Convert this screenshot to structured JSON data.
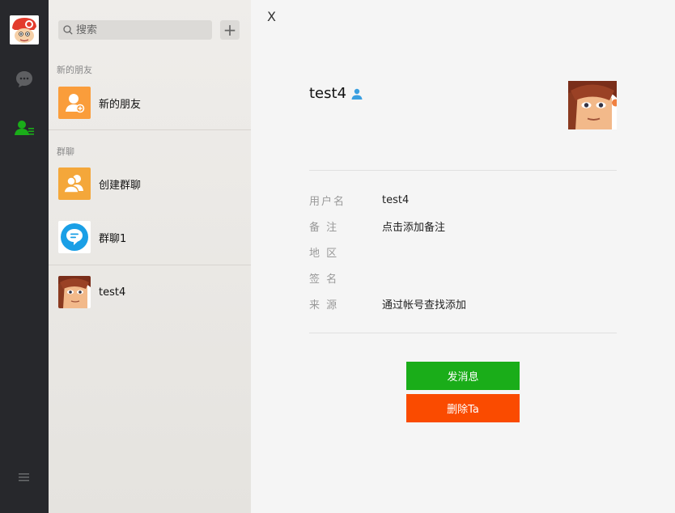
{
  "search": {
    "placeholder": "搜索"
  },
  "add_label": "+",
  "sections": {
    "new_friends": "新的朋友",
    "groups": "群聊"
  },
  "contacts": {
    "new_friends": {
      "name": "新的朋友",
      "icon": "add-friend-icon",
      "color": "#fa9d3b"
    },
    "create_group": {
      "name": "创建群聊",
      "icon": "group-icon",
      "color": "#f4a73a"
    },
    "group1": {
      "name": "群聊1",
      "icon": "chat-bubble-icon",
      "color": "#1a9fe6"
    },
    "test4": {
      "name": "test4",
      "icon": "avatar"
    }
  },
  "detail": {
    "close_label": "X",
    "nickname": "test4",
    "gender_icon": "person-icon",
    "fields": [
      {
        "key": "用户名",
        "value": "test4"
      },
      {
        "key": "备 注",
        "value": "点击添加备注"
      },
      {
        "key": "地 区",
        "value": ""
      },
      {
        "key": "签 名",
        "value": ""
      },
      {
        "key": "来 源",
        "value": "通过帐号查找添加"
      }
    ],
    "send_label": "发消息",
    "delete_label": "删除Ta"
  },
  "colors": {
    "accent_green": "#1aad19",
    "danger": "#fa4b00",
    "rail_bg": "#27282c"
  }
}
